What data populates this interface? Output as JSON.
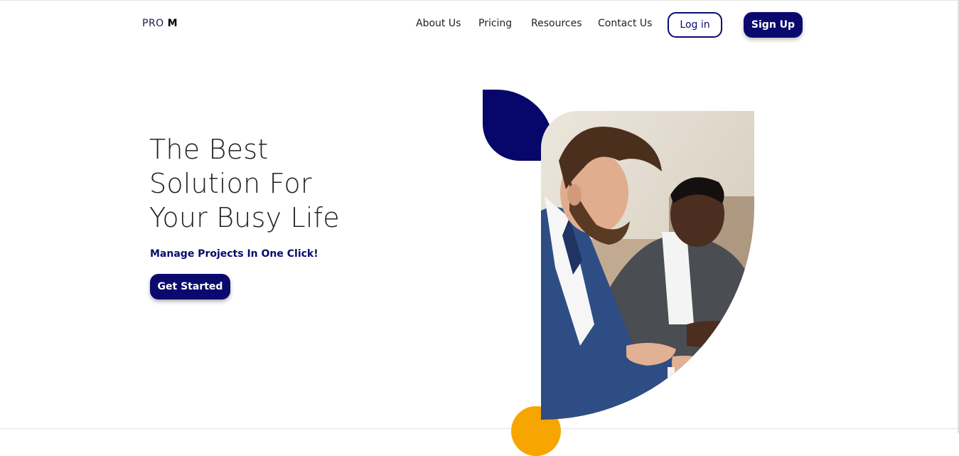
{
  "header": {
    "logo_text": "PRO",
    "logo_mark": "M",
    "nav": [
      {
        "label": "About Us"
      },
      {
        "label": "Pricing"
      },
      {
        "label": "Resources"
      },
      {
        "label": "Contact Us"
      }
    ],
    "login_label": "Log in",
    "signup_label": "Sign Up"
  },
  "hero": {
    "title_lines": [
      "The Best",
      "Solution For",
      "Your Busy Life"
    ],
    "subtitle": "Manage Projects In One Click!",
    "cta_label": "Get Started"
  },
  "colors": {
    "brand_navy": "#0a0a6e",
    "accent_orange": "#f7a500"
  }
}
